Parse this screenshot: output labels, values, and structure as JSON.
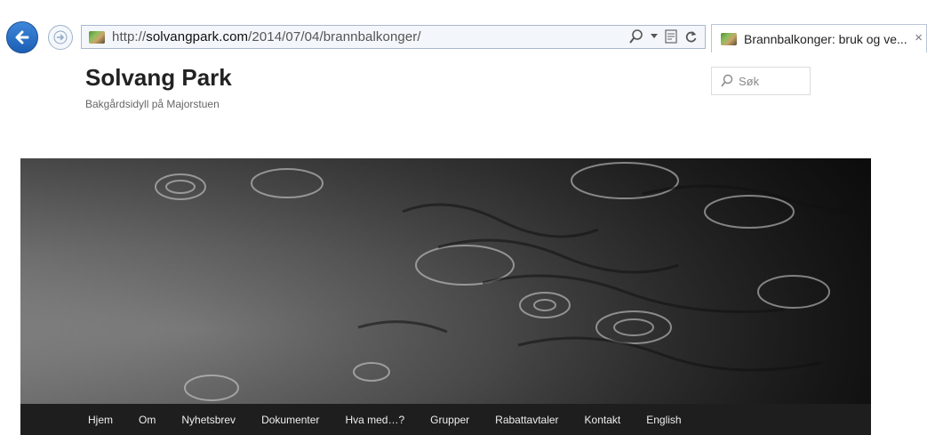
{
  "browser": {
    "url_prefix": "http://",
    "url_domain": "solvangpark.com",
    "url_path": "/2014/07/04/brannbalkonger/",
    "tab_title": "Brannbalkonger: bruk og ve...",
    "tab_close": "×",
    "icons": [
      "back-arrow-icon",
      "forward-arrow-icon",
      "search-icon",
      "dropdown-icon",
      "compat-view-icon",
      "refresh-icon"
    ]
  },
  "site": {
    "title": "Solvang Park",
    "description": "Bakgårdsidyll på Majorstuen"
  },
  "search": {
    "placeholder": "Søk"
  },
  "header_image": {
    "subject": "rain-ripples-photo"
  },
  "nav": {
    "items": [
      {
        "label": "Hjem"
      },
      {
        "label": "Om"
      },
      {
        "label": "Nyhetsbrev"
      },
      {
        "label": "Dokumenter"
      },
      {
        "label": "Hva med…?"
      },
      {
        "label": "Grupper"
      },
      {
        "label": "Rabattavtaler"
      },
      {
        "label": "Kontakt"
      },
      {
        "label": "English"
      }
    ]
  },
  "colors": {
    "nav_background": "#1e1e1e",
    "nav_text": "#eeeeee",
    "title_text": "#222222",
    "back_button": "#2a72c8"
  }
}
